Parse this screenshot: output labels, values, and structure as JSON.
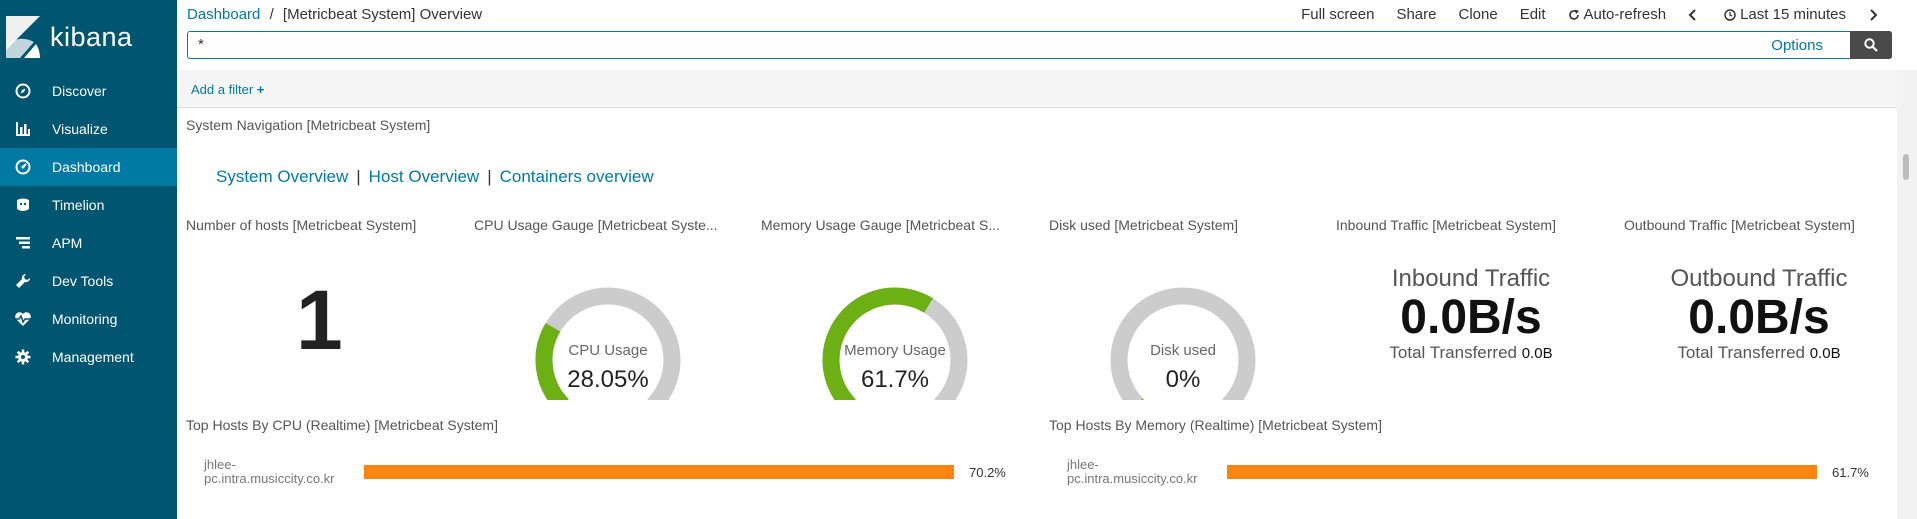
{
  "sidebar": {
    "brand": "kibana",
    "items": [
      {
        "label": "Discover",
        "icon": "compass-icon"
      },
      {
        "label": "Visualize",
        "icon": "bar-chart-icon"
      },
      {
        "label": "Dashboard",
        "icon": "dashboard-icon",
        "active": true
      },
      {
        "label": "Timelion",
        "icon": "timelion-icon"
      },
      {
        "label": "APM",
        "icon": "apm-icon"
      },
      {
        "label": "Dev Tools",
        "icon": "wrench-icon"
      },
      {
        "label": "Monitoring",
        "icon": "heartbeat-icon"
      },
      {
        "label": "Management",
        "icon": "gear-icon"
      }
    ]
  },
  "breadcrumb": {
    "root": "Dashboard",
    "separator": "/",
    "current": "[Metricbeat System] Overview"
  },
  "topmenu": {
    "full_screen": "Full screen",
    "share": "Share",
    "clone": "Clone",
    "edit": "Edit",
    "auto_refresh": "Auto-refresh",
    "time_range": "Last 15 minutes"
  },
  "search": {
    "value": "*",
    "options_label": "Options"
  },
  "filter": {
    "add_label": "Add a filter"
  },
  "panels": {
    "system_nav": {
      "title": "System Navigation [Metricbeat System]",
      "links": [
        "System Overview",
        "Host Overview",
        "Containers overview"
      ]
    },
    "hosts": {
      "title": "Number of hosts [Metricbeat System]",
      "value": "1"
    },
    "cpu": {
      "title": "CPU Usage Gauge [Metricbeat Syste...",
      "label": "CPU Usage",
      "value": "28.05%",
      "fraction": 0.2805
    },
    "memory": {
      "title": "Memory Usage Gauge [Metricbeat S...",
      "label": "Memory Usage",
      "value": "61.7%",
      "fraction": 0.617
    },
    "disk": {
      "title": "Disk used [Metricbeat System]",
      "label": "Disk used",
      "value": "0%",
      "fraction": 0.0
    },
    "inbound": {
      "title": "Inbound Traffic [Metricbeat System]",
      "heading": "Inbound Traffic",
      "value": "0.0B/s",
      "sub_label": "Total Transferred",
      "sub_value": "0.0B"
    },
    "outbound": {
      "title": "Outbound Traffic [Metricbeat System]",
      "heading": "Outbound Traffic",
      "value": "0.0B/s",
      "sub_label": "Total Transferred",
      "sub_value": "0.0B"
    },
    "top_cpu": {
      "title": "Top Hosts By CPU (Realtime) [Metricbeat System]",
      "host_line1": "jhlee-",
      "host_line2": "pc.intra.musiccity.co.kr",
      "value": "70.2%",
      "fraction": 1.0
    },
    "top_mem": {
      "title": "Top Hosts By Memory (Realtime) [Metricbeat System]",
      "host_line1": "jhlee-",
      "host_line2": "pc.intra.musiccity.co.kr",
      "value": "61.7%",
      "fraction": 1.0
    }
  },
  "colors": {
    "sidebar": "#005571",
    "active": "#0079a5",
    "gauge_fill": "#6db014",
    "gauge_track": "#cccccc",
    "bar": "#f98510"
  }
}
